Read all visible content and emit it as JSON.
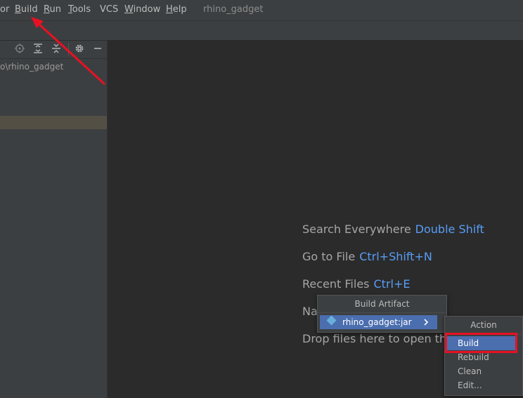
{
  "menubar": {
    "items": [
      {
        "label": "or",
        "mnemonic": ""
      },
      {
        "label": "uild",
        "mnemonic": "B"
      },
      {
        "label": "un",
        "mnemonic": "R"
      },
      {
        "label": "ools",
        "mnemonic": "T"
      },
      {
        "label": "VCS",
        "mnemonic": ""
      },
      {
        "label": "indow",
        "mnemonic": "W"
      },
      {
        "label": "elp",
        "mnemonic": "H"
      }
    ],
    "project_title": "rhino_gadget"
  },
  "sidebar": {
    "path": "o\\rhino_gadget",
    "icons": [
      "locate-icon",
      "expand-all-icon",
      "collapse-all-icon",
      "gear-icon",
      "minimize-icon"
    ]
  },
  "editor": {
    "hints": [
      {
        "label": "Search Everywhere",
        "shortcut": "Double Shift"
      },
      {
        "label": "Go to File",
        "shortcut": "Ctrl+Shift+N"
      },
      {
        "label": "Recent Files",
        "shortcut": "Ctrl+E"
      },
      {
        "label": "Na",
        "shortcut": ""
      },
      {
        "label": "Drop files here to open the",
        "shortcut": ""
      }
    ]
  },
  "build_artifact_popup": {
    "title": "Build Artifact",
    "item_label": "rhino_gadget:jar",
    "item_icon": "artifact-jar-icon"
  },
  "action_popup": {
    "title": "Action",
    "items": [
      "Build",
      "Rebuild",
      "Clean",
      "Edit..."
    ],
    "active_index": 0
  },
  "colors": {
    "accent": "#4b6eaf",
    "highlight": "#e81123",
    "shortcut": "#589df6"
  }
}
